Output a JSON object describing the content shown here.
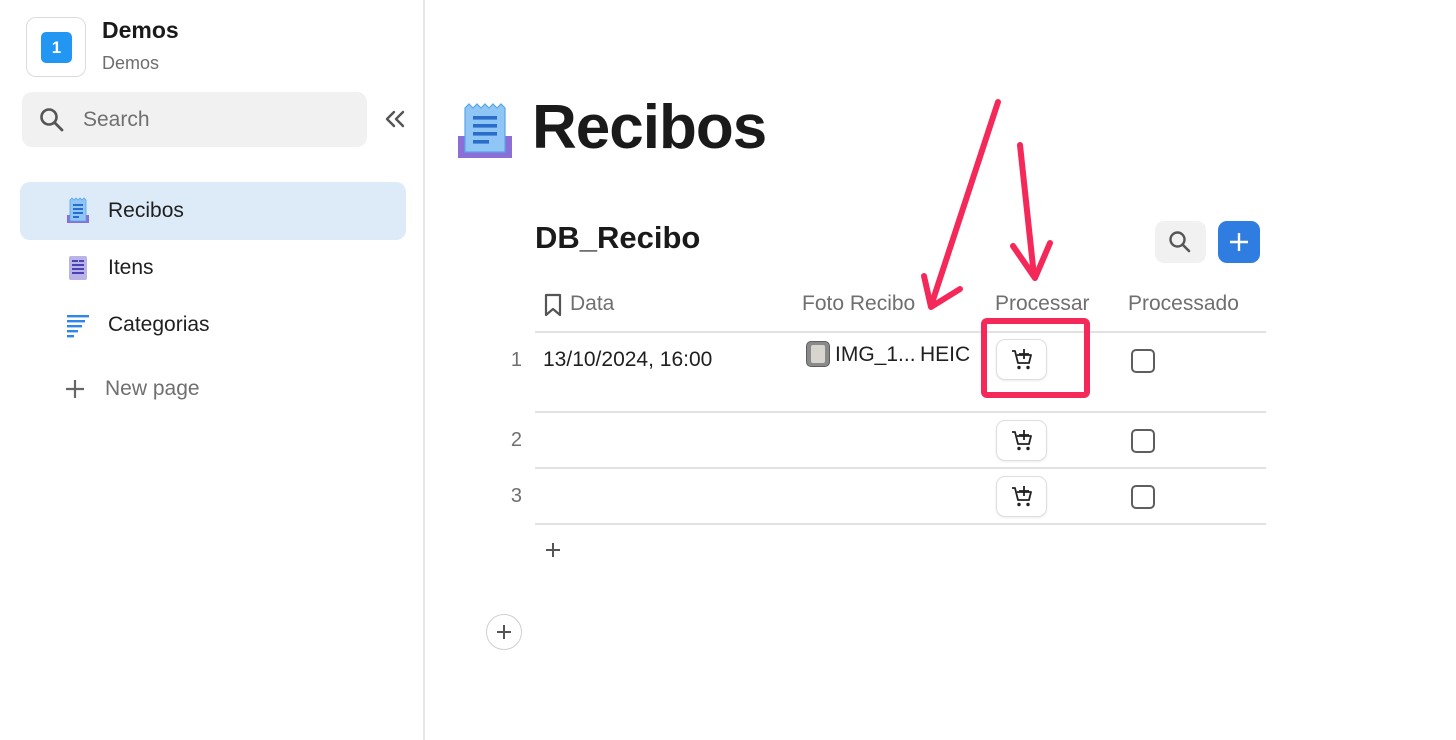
{
  "workspace": {
    "logo_text": "1",
    "title": "Demos",
    "subtitle": "Demos"
  },
  "sidebar": {
    "search_label": "Search",
    "items": [
      {
        "label": "Recibos",
        "icon": "receipt-icon",
        "active": true
      },
      {
        "label": "Itens",
        "icon": "document-list-icon",
        "active": false
      },
      {
        "label": "Categorias",
        "icon": "list-lines-icon",
        "active": false
      }
    ],
    "new_page_label": "New page"
  },
  "page": {
    "title": "Recibos",
    "icon": "receipt-icon"
  },
  "database": {
    "title": "DB_Recibo",
    "columns": [
      "Data",
      "Foto Recibo",
      "Processar",
      "Processado"
    ],
    "rows": [
      {
        "num": "1",
        "data": "13/10/2024, 16:00",
        "file_name": "IMG_1...",
        "file_ext": "HEIC",
        "processado": false
      },
      {
        "num": "2",
        "data": "",
        "file_name": "",
        "file_ext": "",
        "processado": false
      },
      {
        "num": "3",
        "data": "",
        "file_name": "",
        "file_ext": "",
        "processado": false
      }
    ]
  },
  "colors": {
    "accent": "#2f7de1",
    "active_nav": "#dcebf7",
    "annotation": "#f5285a"
  }
}
